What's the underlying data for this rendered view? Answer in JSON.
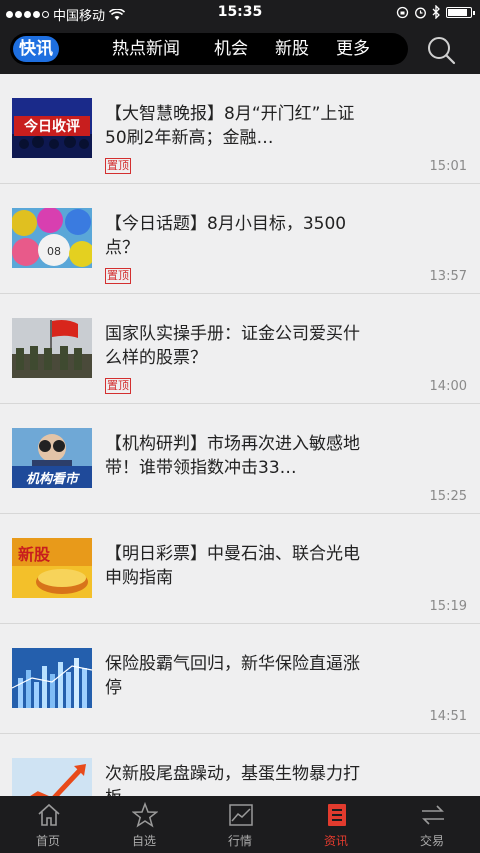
{
  "status_bar": {
    "carrier": "中国移动",
    "time": "15:35"
  },
  "tabs": [
    {
      "label": "快讯",
      "active": true
    },
    {
      "label": "热点新闻"
    },
    {
      "label": "机会"
    },
    {
      "label": "新股"
    },
    {
      "label": "更多"
    }
  ],
  "news": [
    {
      "title": "【大智慧晚报】8月“开门红”上证50刷2年新高；金融…",
      "badge": "置顶",
      "time": "15:01",
      "thumb_text": "今日收评"
    },
    {
      "title": "【今日话题】8月小目标，3500点？",
      "badge": "置顶",
      "time": "13:57",
      "thumb_text": ""
    },
    {
      "title": "国家队实操手册：证金公司爱买什么样的股票？",
      "badge": "置顶",
      "time": "14:00",
      "thumb_text": ""
    },
    {
      "title": "【机构研判】市场再次进入敏感地带！谁带领指数冲击33…",
      "badge": "",
      "time": "15:25",
      "thumb_text": "机构看市"
    },
    {
      "title": "【明日彩票】中曼石油、联合光电申购指南",
      "badge": "",
      "time": "15:19",
      "thumb_text": "新股"
    },
    {
      "title": "保险股霸气回归，新华保险直逼涨停",
      "badge": "",
      "time": "14:51",
      "thumb_text": ""
    },
    {
      "title": "次新股尾盘躁动，基蛋生物暴力打板",
      "badge": "",
      "time": "",
      "thumb_text": ""
    }
  ],
  "tabbar": [
    {
      "label": "首页",
      "icon": "home-icon"
    },
    {
      "label": "自选",
      "icon": "star-icon"
    },
    {
      "label": "行情",
      "icon": "chart-icon"
    },
    {
      "label": "资讯",
      "icon": "news-icon",
      "active": true
    },
    {
      "label": "交易",
      "icon": "trade-icon"
    }
  ],
  "colors": {
    "active_tab": "#1e6fe0",
    "accent_red": "#e23b2e",
    "header_bg": "#1c1c1e"
  }
}
